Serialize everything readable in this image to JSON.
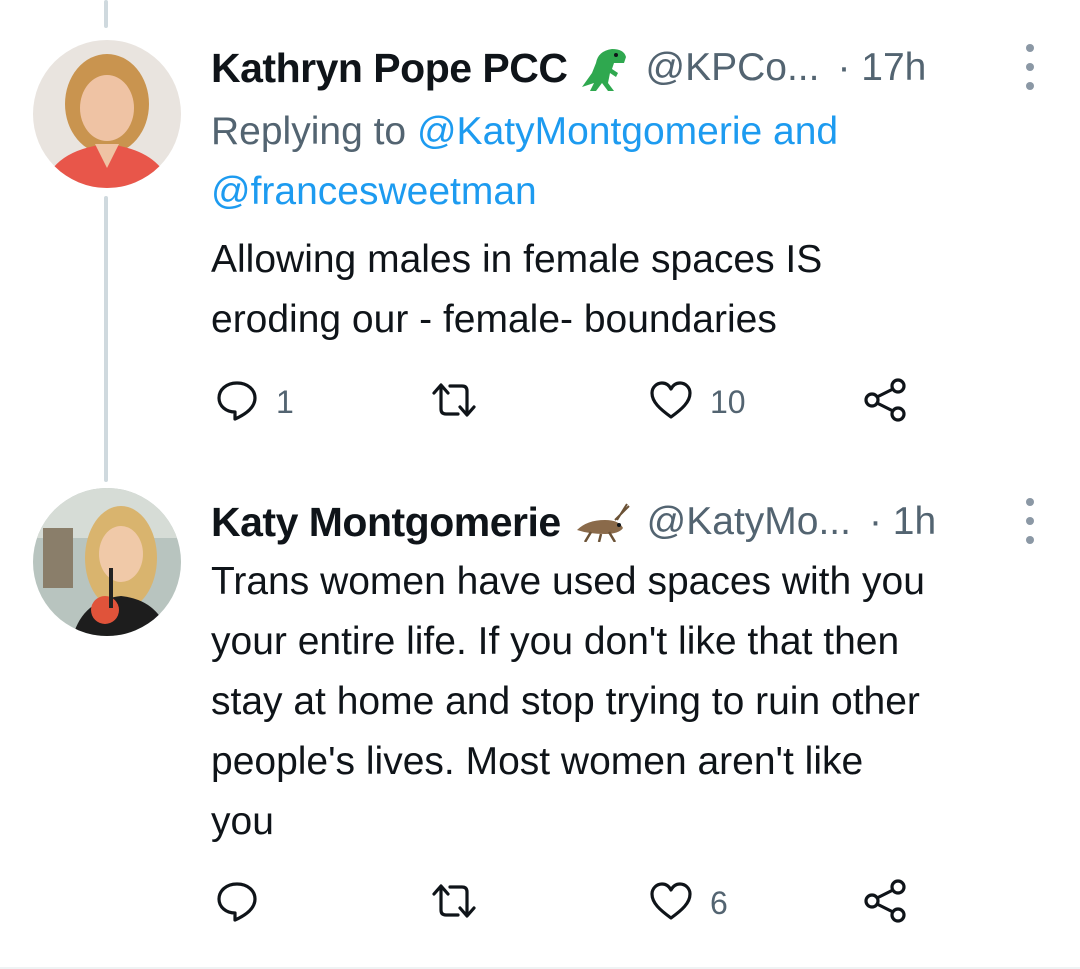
{
  "colors": {
    "link": "#1d9bf0",
    "secondary_text": "#536471",
    "primary_text": "#0f1419",
    "thread_line": "#cfd9de"
  },
  "tweets": [
    {
      "display_name": "Kathryn Pope PCC",
      "name_emoji": "t-rex-emoji",
      "handle": "@KPCo...",
      "time": "· 17h",
      "replying_prefix": "Replying to",
      "reply_mention_1": "@KatyMontgomerie",
      "reply_and": " and",
      "reply_mention_2": "@francesweetman",
      "text_lines": [
        "Allowing males in female spaces IS",
        "eroding our - female- boundaries"
      ],
      "reply_count": "1",
      "retweet_count": "",
      "like_count": "10",
      "avatar": "avatar-photo"
    },
    {
      "display_name": "Katy Montgomerie",
      "name_emoji": "cricket-emoji",
      "handle": "@KatyMo...",
      "time": "· 1h",
      "text_lines": [
        "Trans women have used spaces with you",
        "your entire life. If you don't like that then",
        "stay at home and stop trying to ruin other",
        "people's lives. Most women aren't like",
        "you"
      ],
      "reply_count": "",
      "retweet_count": "",
      "like_count": "6",
      "avatar": "avatar-photo"
    }
  ]
}
